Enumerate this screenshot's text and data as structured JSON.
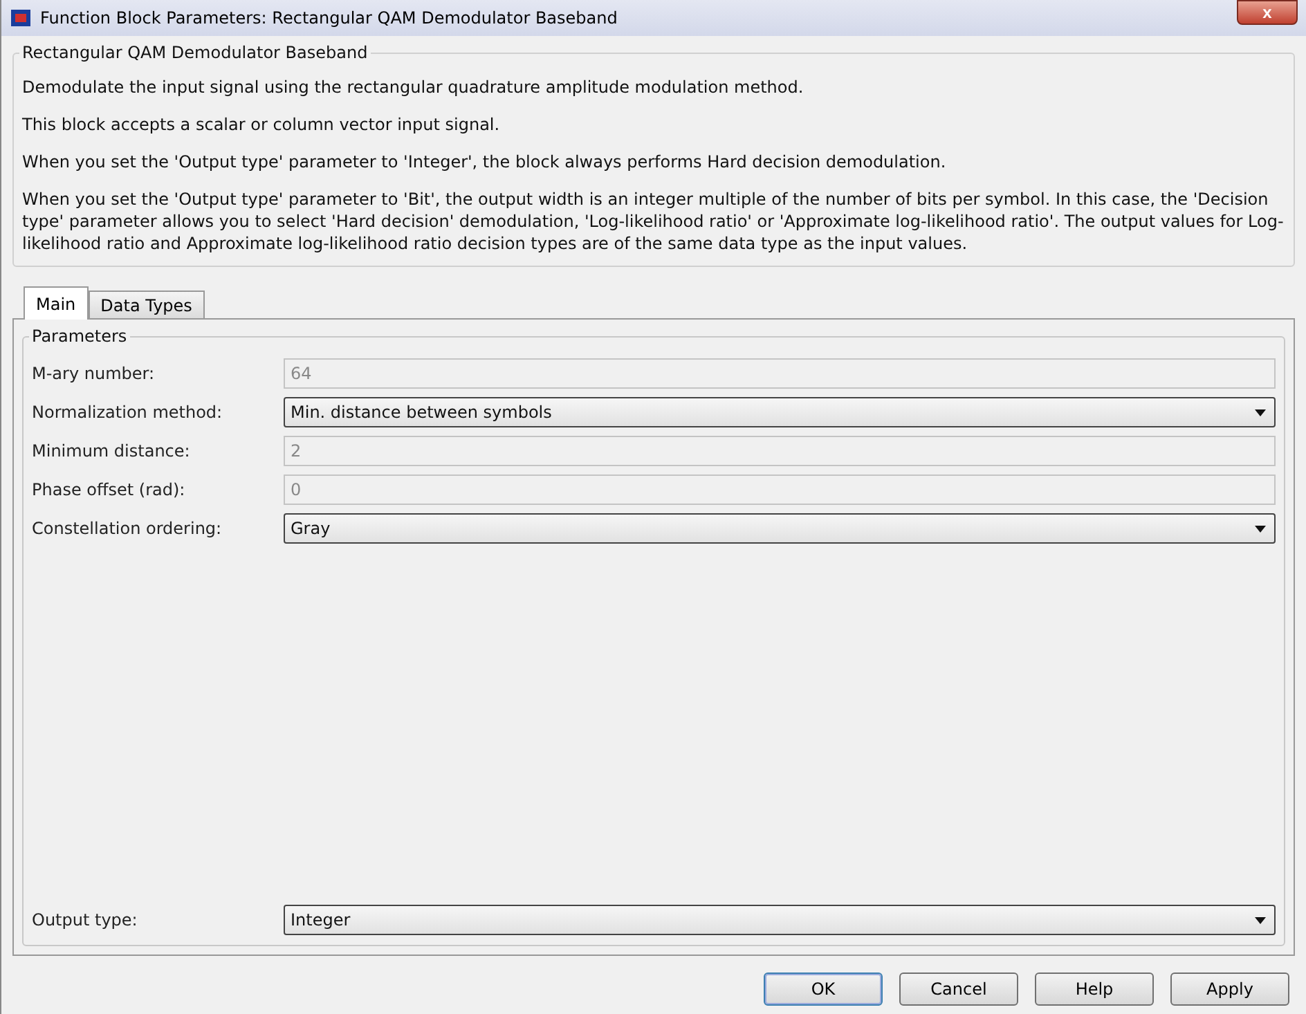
{
  "window": {
    "title": "Function Block Parameters: Rectangular QAM Demodulator Baseband",
    "close": "x"
  },
  "description": {
    "title": "Rectangular QAM Demodulator Baseband",
    "paragraphs": [
      "Demodulate the input signal using the rectangular quadrature amplitude modulation method.",
      "This block accepts a scalar or column vector input signal.",
      "When you set the 'Output type' parameter to 'Integer', the block always performs Hard decision demodulation.",
      "When you set the 'Output type' parameter to 'Bit', the output width is an integer multiple of the number of bits per symbol. In this case, the 'Decision type' parameter allows you to select 'Hard decision' demodulation, 'Log-likelihood ratio' or 'Approximate log-likelihood ratio'. The output values for Log-likelihood ratio and Approximate log-likelihood ratio decision types are of the same data type as the input values."
    ]
  },
  "tabs": [
    {
      "label": "Main",
      "selected": true
    },
    {
      "label": "Data Types",
      "selected": false
    }
  ],
  "parameters": {
    "title": "Parameters",
    "rows": [
      {
        "kind": "edit",
        "label": "M-ary number:",
        "value": "64",
        "disabled": true
      },
      {
        "kind": "popup",
        "label": "Normalization method:",
        "value": "Min. distance between symbols",
        "disabled": false
      },
      {
        "kind": "edit",
        "label": "Minimum distance:",
        "value": "2",
        "disabled": true
      },
      {
        "kind": "edit",
        "label": "Phase offset (rad):",
        "value": "0",
        "disabled": true
      },
      {
        "kind": "popup",
        "label": "Constellation ordering:",
        "value": "Gray",
        "disabled": false
      },
      {
        "kind": "spacer"
      },
      {
        "kind": "popup",
        "label": "Output type:",
        "value": "Integer",
        "disabled": false
      }
    ]
  },
  "buttons": [
    {
      "label": "OK",
      "default": true
    },
    {
      "label": "Cancel",
      "default": false
    },
    {
      "label": "Help",
      "default": false
    },
    {
      "label": "Apply",
      "default": false
    }
  ]
}
